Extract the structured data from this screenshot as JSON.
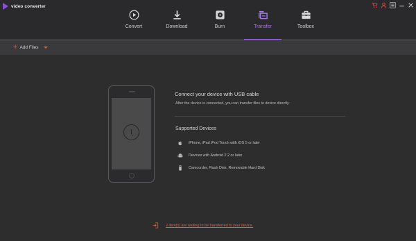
{
  "app": {
    "title": "video converter",
    "logo_icon": "play-logo-icon"
  },
  "window_controls": [
    {
      "name": "cart-icon",
      "glyph": "cart"
    },
    {
      "name": "user-icon",
      "glyph": "user"
    },
    {
      "name": "menu-icon",
      "glyph": "menu"
    },
    {
      "name": "minimize-icon",
      "glyph": "min"
    },
    {
      "name": "close-icon",
      "glyph": "close"
    }
  ],
  "nav": {
    "tabs": [
      {
        "id": "convert",
        "label": "Convert",
        "icon": "convert-icon"
      },
      {
        "id": "download",
        "label": "Download",
        "icon": "download-icon"
      },
      {
        "id": "burn",
        "label": "Burn",
        "icon": "burn-icon"
      },
      {
        "id": "transfer",
        "label": "Transfer",
        "icon": "transfer-icon",
        "active": true
      },
      {
        "id": "toolbox",
        "label": "Toolbox",
        "icon": "toolbox-icon"
      }
    ]
  },
  "toolbar": {
    "add_files_label": "Add Files",
    "add_files_icon": "plus-icon",
    "dropdown_icon": "chevron-down-icon"
  },
  "connect": {
    "title": "Connect your device with USB cable",
    "subtitle": "After the device is connected, you can transfer files to device directly."
  },
  "supported": {
    "title": "Supported Devices",
    "items": [
      {
        "icon": "apple-icon",
        "label": "iPhone, iPad iPod Touch with iOS 5 or later"
      },
      {
        "icon": "android-icon",
        "label": "Devices with Android 2.2 or later"
      },
      {
        "icon": "usb-drive-icon",
        "label": "Camcorder, Flash Disk, Removable Hard Disk"
      }
    ]
  },
  "footer": {
    "icon": "transfer-queue-icon",
    "link_text": "2 item(s) are waiting to be transferred to your device."
  },
  "colors": {
    "accent_purple": "#9a60ec",
    "accent_orange": "#e0623a",
    "background": "#2e2d2e"
  }
}
